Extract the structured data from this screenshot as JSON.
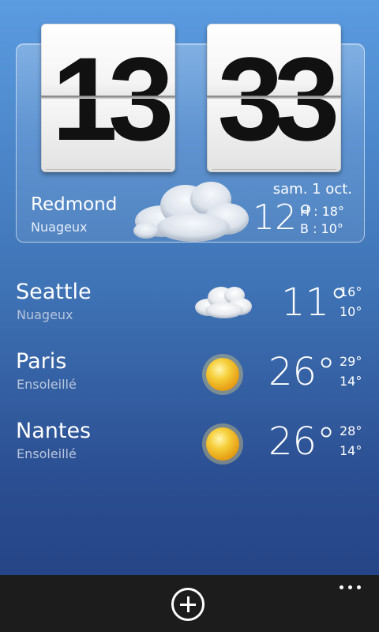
{
  "clock": {
    "hours": "13",
    "minutes": "33"
  },
  "local": {
    "city": "Redmond",
    "condition": "Nuageux",
    "date": "sam. 1 oct.",
    "temp": "12°",
    "high": "H : 18°",
    "low": "B : 10°",
    "icon": "cloud-icon"
  },
  "cities": [
    {
      "name": "Seattle",
      "condition": "Nuageux",
      "temp": "11°",
      "high": "16°",
      "low": "10°",
      "icon": "cloud-icon"
    },
    {
      "name": "Paris",
      "condition": "Ensoleillé",
      "temp": "26°",
      "high": "29°",
      "low": "14°",
      "icon": "sun-icon"
    },
    {
      "name": "Nantes",
      "condition": "Ensoleillé",
      "temp": "26°",
      "high": "28°",
      "low": "14°",
      "icon": "sun-icon"
    }
  ],
  "appbar": {
    "add_icon": "add-circle-icon",
    "more_icon": "more-dots-icon"
  },
  "colors": {
    "background_top": "#5b9be0",
    "background_bottom": "#223f80",
    "appbar": "#1c1c1c",
    "sun": "#f2c12a"
  }
}
